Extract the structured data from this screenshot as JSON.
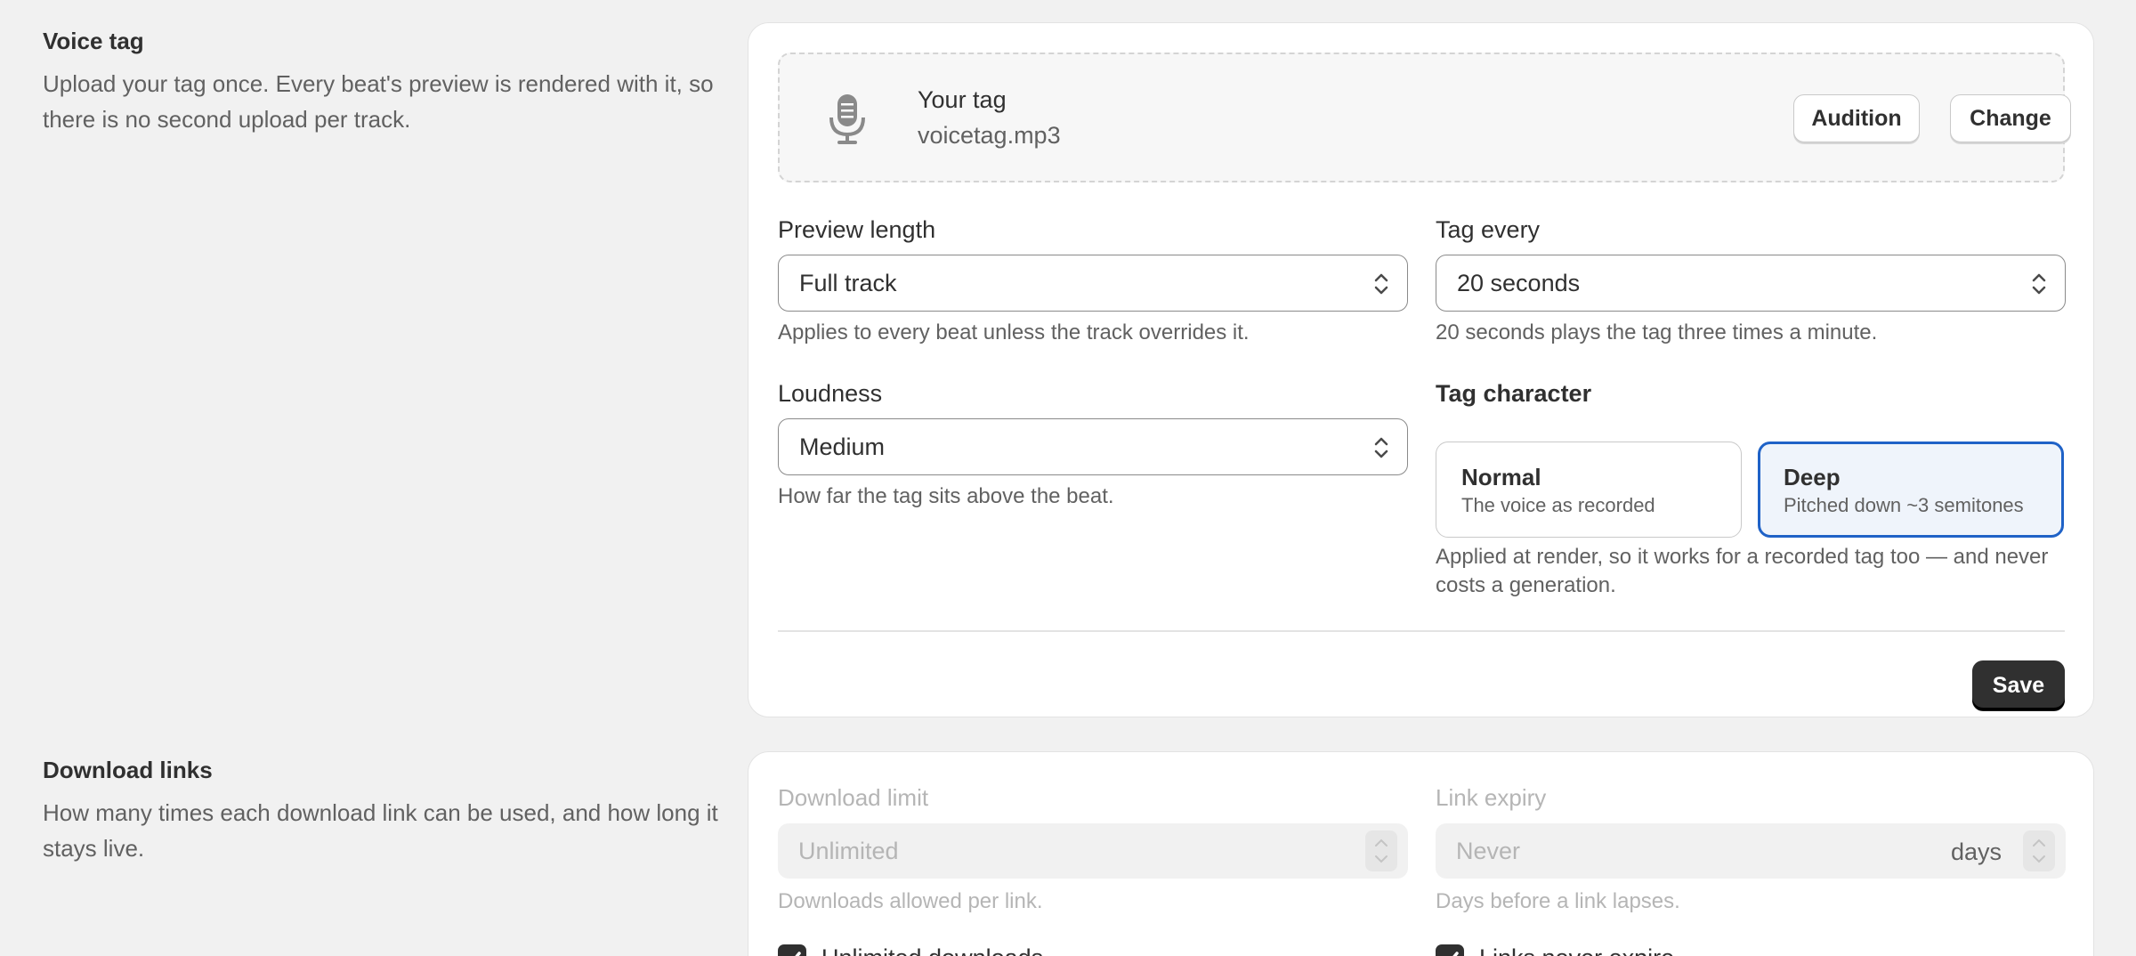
{
  "voice_tag": {
    "title": "Voice tag",
    "description": "Upload your tag once. Every beat's preview is rendered with it, so there is no second upload per track.",
    "icon": "microphone-icon",
    "tag_label": "Your tag",
    "filename": "voicetag.mp3",
    "audition_label": "Audition",
    "change_label": "Change",
    "preview_length": {
      "label": "Preview length",
      "value": "Full track",
      "help": "Applies to every beat unless the track overrides it."
    },
    "tag_every": {
      "label": "Tag every",
      "value": "20 seconds",
      "help": "20 seconds plays the tag three times a minute."
    },
    "loudness": {
      "label": "Loudness",
      "value": "Medium",
      "help": "How far the tag sits above the beat."
    },
    "tag_character": {
      "label": "Tag character",
      "options": [
        {
          "title": "Normal",
          "subtitle": "The voice as recorded",
          "selected": false
        },
        {
          "title": "Deep",
          "subtitle": "Pitched down ~3 semitones",
          "selected": true
        }
      ],
      "help": "Applied at render, so it works for a recorded tag too — and never costs a generation."
    },
    "save_label": "Save"
  },
  "download_links": {
    "title": "Download links",
    "description": "How many times each download link can be used, and how long it stays live.",
    "download_limit": {
      "label": "Download limit",
      "placeholder": "Unlimited",
      "help": "Downloads allowed per link.",
      "checkbox_label": "Unlimited downloads",
      "checked": true
    },
    "link_expiry": {
      "label": "Link expiry",
      "placeholder": "Never",
      "suffix": "days",
      "help": "Days before a link lapses.",
      "checkbox_label": "Links never expire",
      "checked": true
    }
  },
  "colors": {
    "page_bg": "#f1f1f1",
    "card_bg": "#ffffff",
    "accent_blue": "#1f62c7",
    "primary_button": "#303030"
  }
}
